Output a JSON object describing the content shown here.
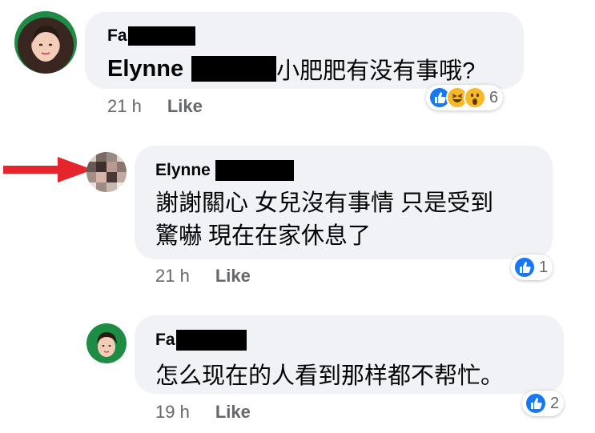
{
  "comments": [
    {
      "author_prefix": "Fa",
      "mention": "Elynne",
      "text": "小肥肥有没有事哦?",
      "time": "21 h",
      "like_label": "Like",
      "reaction_count": "6"
    },
    {
      "author": "Elynne",
      "text_line1": "謝謝關心 女兒沒有事情 只是受到",
      "text_line2": "驚嚇 現在在家休息了",
      "time": "21 h",
      "like_label": "Like",
      "reaction_count": "1"
    },
    {
      "author_prefix": "Fa",
      "text": "怎么现在的人看到那样都不帮忙。",
      "time": "19 h",
      "like_label": "Like",
      "reaction_count": "2"
    }
  ],
  "colors": {
    "bubble": "#f0f2f5",
    "like_blue": "#1877f2",
    "emoji_yellow": "#f7b928",
    "arrow_red": "#e4252b",
    "meta_gray": "#65676b"
  }
}
